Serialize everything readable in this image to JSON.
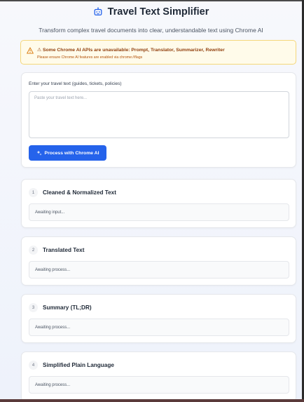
{
  "header": {
    "title": "Travel Text Simplifier",
    "subtitle": "Transform complex travel documents into clear, understandable text using Chrome AI",
    "icon": "robot-icon"
  },
  "warning": {
    "message": "⚠ Some Chrome AI APIs are unavailable: Prompt, Translator, Summarizer, Rewriter",
    "hint": "Please ensure Chrome AI features are enabled via chrome://flags",
    "icon": "warning-triangle-icon",
    "color": "#92400e"
  },
  "input": {
    "label": "Enter your travel text (guides, tickets, policies)",
    "placeholder": "Paste your travel text here...",
    "value": ""
  },
  "process_button": {
    "label": "Process with Chrome AI",
    "icon": "sparkle-icon",
    "color": "#2563eb"
  },
  "steps": [
    {
      "number": "1",
      "title": "Cleaned & Normalized Text",
      "status": "Awaiting input..."
    },
    {
      "number": "2",
      "title": "Translated Text",
      "status": "Awaiting process..."
    },
    {
      "number": "3",
      "title": "Summary (TL;DR)",
      "status": "Awaiting process..."
    },
    {
      "number": "4",
      "title": "Simplified Plain Language",
      "status": "Awaiting process..."
    }
  ]
}
